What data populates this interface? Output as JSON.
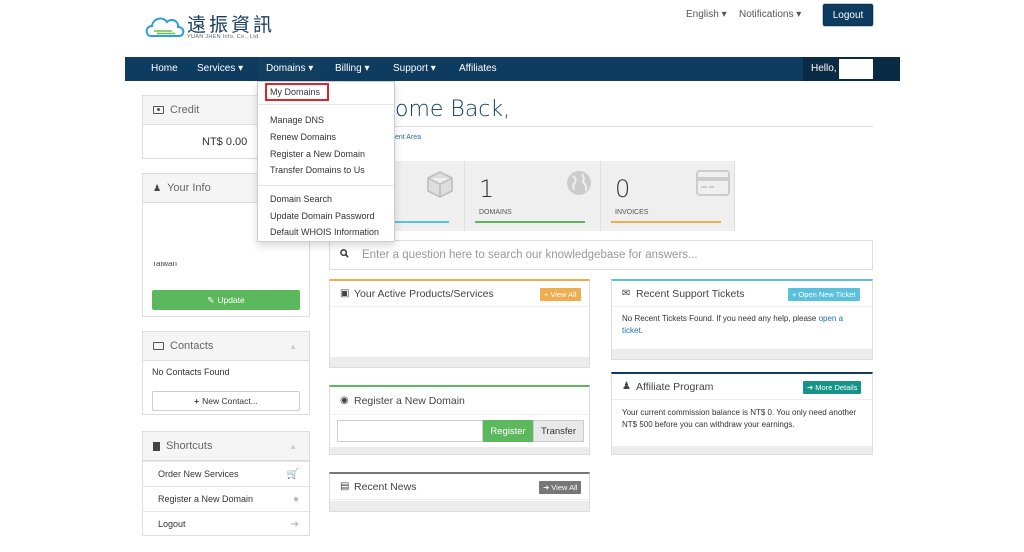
{
  "brand": {
    "name": "遠振資訊",
    "sub": "YUAN JHEN Info. Co., Ltd"
  },
  "topbar": {
    "language": "English ▾",
    "notifications": "Notifications ▾",
    "logout": "Logout"
  },
  "nav": {
    "items": [
      "Home",
      "Services ▾",
      "Domains ▾",
      "Billing ▾",
      "Support ▾",
      "Affiliates"
    ],
    "hello": "Hello,"
  },
  "dropdown": {
    "group1": [
      "My Domains"
    ],
    "group2": [
      "Manage DNS",
      "Renew Domains",
      "Register a New Domain",
      "Transfer Domains to Us"
    ],
    "group3": [
      "Domain Search",
      "Update Domain Password",
      "Default WHOIS Information"
    ]
  },
  "page": {
    "welcome": "ome Back,",
    "breadcrumb": "ent Area"
  },
  "sidebar": {
    "credit": {
      "title": "Credit",
      "amount": "NT$ 0.00"
    },
    "info": {
      "title": "Your Info",
      "country": "Taiwan",
      "update": "Update"
    },
    "contacts": {
      "title": "Contacts",
      "empty": "No Contacts Found",
      "new_btn": "New Contact..."
    },
    "shortcuts": {
      "title": "Shortcuts",
      "items": [
        "Order New Services",
        "Register a New Domain",
        "Logout"
      ]
    }
  },
  "stats": [
    {
      "num": "1",
      "label": "DOMAINS",
      "color": "#5cb85c"
    },
    {
      "num": "0",
      "label": "INVOICES",
      "color": "#f0ad4e"
    }
  ],
  "search": {
    "placeholder": "Enter a question here to search our knowledgebase for answers..."
  },
  "products": {
    "title": "Your Active Products/Services",
    "view_all": "View All"
  },
  "register": {
    "title": "Register a New Domain",
    "register": "Register",
    "transfer": "Transfer"
  },
  "news": {
    "title": "Recent News",
    "view_all": "View All"
  },
  "tickets": {
    "title": "Recent Support Tickets",
    "open_btn": "Open New Ticket",
    "body": "No Recent Tickets Found. If you need any help, please",
    "link": "open a ticket",
    "end": "."
  },
  "affiliate": {
    "title": "Affiliate Program",
    "details_btn": "More Details",
    "body": "Your current commission balance is NT$ 0. You only need another NT$ 500 before you can withdraw your earnings."
  },
  "colors": {
    "navy": "#0e3c60",
    "green": "#5cb85c",
    "orange": "#f0ad4e",
    "teal": "#5bc0de",
    "highlight": "#d9262c"
  }
}
